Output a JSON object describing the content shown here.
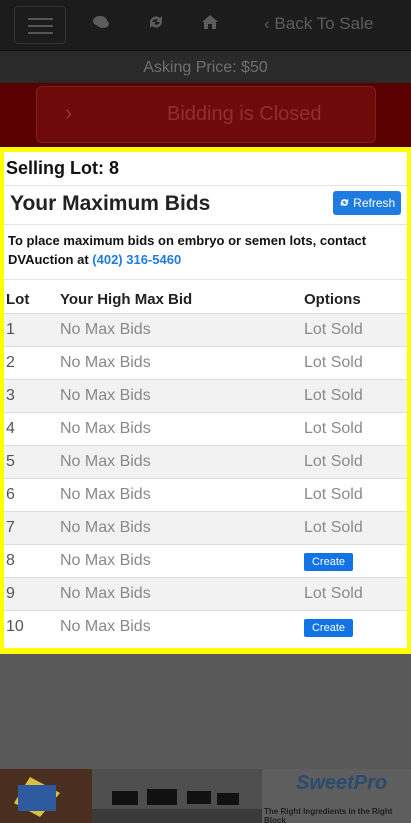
{
  "nav": {
    "icons": {
      "menu": "menu-icon",
      "chat": "chat-icon",
      "refresh": "sync-icon",
      "home": "home-icon"
    },
    "back_chevron": "‹",
    "back_label": "Back To Sale"
  },
  "asking_price": "Asking Price: $50",
  "bidding": {
    "chevron": "›",
    "status": "Bidding is Closed"
  },
  "lot": {
    "selling": "Selling Lot: 8"
  },
  "max_bids": {
    "title": "Your Maximum Bids",
    "refresh_label": "Refresh",
    "info_text": "To place maximum bids on embryo or semen lots, contact DVAuction at",
    "phone": "(402) 316-5460"
  },
  "table": {
    "headers": [
      "Lot",
      "Your High Max Bid",
      "Options"
    ],
    "rows": [
      {
        "lot": "1",
        "bid": "No Max Bids",
        "option": "Lot Sold",
        "action": false
      },
      {
        "lot": "2",
        "bid": "No Max Bids",
        "option": "Lot Sold",
        "action": false
      },
      {
        "lot": "3",
        "bid": "No Max Bids",
        "option": "Lot Sold",
        "action": false
      },
      {
        "lot": "4",
        "bid": "No Max Bids",
        "option": "Lot Sold",
        "action": false
      },
      {
        "lot": "5",
        "bid": "No Max Bids",
        "option": "Lot Sold",
        "action": false
      },
      {
        "lot": "6",
        "bid": "No Max Bids",
        "option": "Lot Sold",
        "action": false
      },
      {
        "lot": "7",
        "bid": "No Max Bids",
        "option": "Lot Sold",
        "action": false
      },
      {
        "lot": "8",
        "bid": "No Max Bids",
        "option": "Create",
        "action": true
      },
      {
        "lot": "9",
        "bid": "No Max Bids",
        "option": "Lot Sold",
        "action": false
      },
      {
        "lot": "10",
        "bid": "No Max Bids",
        "option": "Create",
        "action": true
      }
    ]
  },
  "ad": {
    "brand": "SweetPro",
    "tagline": "The Right Ingredients in the Right Block"
  },
  "colors": {
    "highlight": "#ffff00",
    "primary": "#1e7be0",
    "closed_bar": "#5a0000"
  }
}
